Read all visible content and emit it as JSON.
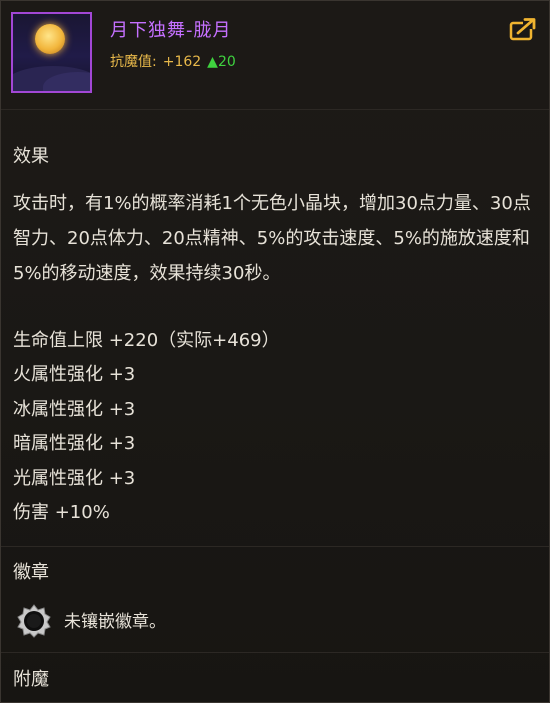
{
  "item": {
    "name": "月下独舞-胧月",
    "stat_label": "抗魔值:",
    "stat_value": "+162",
    "stat_delta_icon": "up-arrow-icon",
    "stat_delta": "20"
  },
  "colors": {
    "item_name": "#c570ff",
    "stat": "#e7b84a",
    "delta": "#3fd23f",
    "share_button": "#f0b430"
  },
  "effect": {
    "title": "效果",
    "description": "攻击时，有1%的概率消耗1个无色小晶块，增加30点力量、30点智力、20点体力、20点精神、5%的攻击速度、5%的施放速度和5%的移动速度，效果持续30秒。",
    "attributes": [
      "生命值上限 +220（实际+469）",
      "火属性强化 +3",
      "冰属性强化 +3",
      "暗属性强化 +3",
      "光属性强化 +3",
      "伤害 +10%"
    ]
  },
  "emblem": {
    "title": "徽章",
    "socket_icon": "empty-socket-icon",
    "socket_text": "未镶嵌徽章。"
  },
  "enchant": {
    "title": "附魔"
  }
}
